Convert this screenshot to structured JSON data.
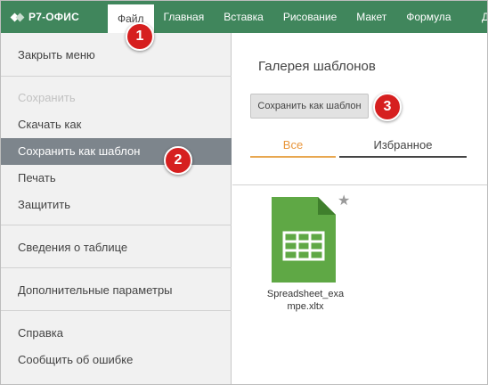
{
  "app": {
    "logo_text": "Р7-ОФИС"
  },
  "tabs": [
    {
      "label": "Файл",
      "active": true
    },
    {
      "label": "Главная"
    },
    {
      "label": "Вставка"
    },
    {
      "label": "Рисование"
    },
    {
      "label": "Макет"
    },
    {
      "label": "Формула"
    },
    {
      "label": "Д"
    }
  ],
  "menu": {
    "close": "Закрыть меню",
    "save": "Сохранить",
    "download_as": "Скачать как",
    "save_as_template": "Сохранить как шаблон",
    "print": "Печать",
    "protect": "Защитить",
    "info": "Сведения о таблице",
    "advanced": "Дополнительные параметры",
    "help": "Справка",
    "report": "Сообщить об ошибке"
  },
  "panel": {
    "title": "Галерея шаблонов",
    "save_button": "Сохранить как шаблон",
    "filter_all": "Все",
    "filter_favorites": "Избранное",
    "template_name": "Spreadsheet_exa\nmpe.xltx"
  },
  "badges": {
    "b1": "1",
    "b2": "2",
    "b3": "3"
  },
  "colors": {
    "topbar": "#40865c",
    "file_icon": "#5fa845",
    "accent_filter": "#e8963c",
    "badge": "#d61f1f",
    "selected_item": "#7d858c"
  },
  "icons": {
    "logo": "r7-logo-icon",
    "file": "spreadsheet-template-icon",
    "star": "favorite-star-icon"
  }
}
